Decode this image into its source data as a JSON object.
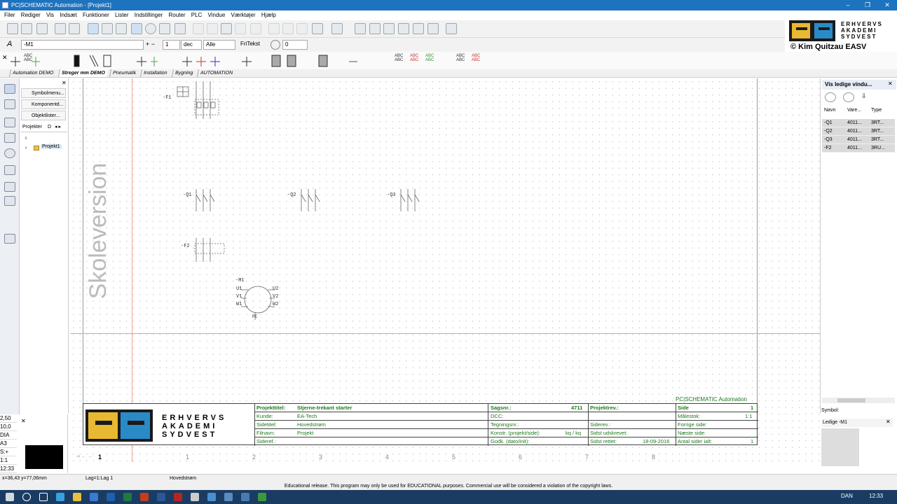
{
  "window": {
    "title": "PC|SCHEMATIC Automation - [Projekt1]"
  },
  "menu": [
    "Filer",
    "Rediger",
    "Vis",
    "Indsæt",
    "Funktioner",
    "Lister",
    "Indstillinger",
    "Router",
    "PLC",
    "Vindue",
    "Værktøjer",
    "Hjælp"
  ],
  "toolbar2": {
    "component_field": "-M1",
    "step": "1",
    "number_format": "dec",
    "filter": "Alle",
    "text_button": "FriTekst",
    "angle": "0"
  },
  "brand": {
    "line1": "ERHVERVS",
    "line2": "AKADEMI",
    "line3": "SYDVEST",
    "copyright": "© Kim Quitzau EASV"
  },
  "symbol_labels": [
    "ABC",
    "ABC",
    "ABC",
    "ABC",
    "ABC",
    "ABC",
    "ABC",
    "ABC",
    "ABC",
    "ABC",
    "ABC",
    "ABC"
  ],
  "tabs": [
    "Automation DEMO",
    "Streger mm DEMO",
    "Pneumatik",
    "Installation",
    "Bygning",
    "AUTOMATION"
  ],
  "active_tab": "Streger mm DEMO",
  "explorer": {
    "buttons": [
      "Symbolmenu...",
      "Komponentd...",
      "Objektlister..."
    ],
    "tab": "Projekter",
    "tab2": "D",
    "tree_item": "Projekt1"
  },
  "canvas": {
    "watermark": "Skoleversion",
    "page_number": "1",
    "ruler": [
      "1",
      "2",
      "3",
      "4",
      "5",
      "6",
      "7",
      "8"
    ]
  },
  "components": {
    "F1": "-F1",
    "Q1": "-Q1",
    "Q2": "-Q2",
    "Q3": "-Q3",
    "F2": "-F2",
    "M1": "-M1",
    "motor_left": [
      "U1",
      "V1",
      "W1"
    ],
    "motor_right": [
      "U2",
      "V2",
      "W2"
    ],
    "motor_bottom": "PE"
  },
  "title_block": {
    "product": "PC|SCHEMATIC Automation",
    "school": [
      "ERHVERVS",
      "AKADEMI",
      "SYDVEST"
    ],
    "projekttitel_label": "Projekttitel:",
    "projekttitel": "Stjerne-trekant starter",
    "kunde_label": "Kunde:",
    "kunde": "EA-Tech",
    "sidetitel_label": "Sidetitel:",
    "sidetitel": "Hovedstrøm",
    "filnavn_label": "Filnavn:",
    "filnavn": "Projekt",
    "sideref_label": "Sideref.:",
    "sagsnr_label": "Sagsnr.:",
    "sagsnr": "4711",
    "dcc_label": "DCC:",
    "tegningsnr_label": "Tegningsnr.:",
    "konstr_label": "Konstr. (projekt/side):",
    "konstr": "kq / kq",
    "godk_label": "Godk. (dato/init):",
    "projektrev_label": "Projektrev.:",
    "siderev_label": "Siderev.:",
    "sidst_udskrevet_label": "Sidst udskrevet:",
    "sidst_rettet_label": "Sidst rettet:",
    "sidst_rettet": "18-09-2016",
    "side_label": "Side",
    "side": "1",
    "malestok_label": "Målestok:",
    "malestok": "1:1",
    "forrige_label": "Forrige side:",
    "naeste_label": "Næste side:",
    "antal_label": "Antal sider ialt:",
    "antal": "1"
  },
  "right_panel": {
    "title": "Vis ledige vindu...",
    "columns": [
      "Navn",
      "Vare...",
      "Type"
    ],
    "rows": [
      [
        "-Q1",
        "4011...",
        "3RT..."
      ],
      [
        "-Q2",
        "4011...",
        "3RT..."
      ],
      [
        "-Q3",
        "4011...",
        "3RT..."
      ],
      [
        "-F2",
        "4011...",
        "3RU..."
      ]
    ],
    "symbol_label": "Symbol:",
    "symbol_value": "Ledige -M1"
  },
  "zoom": [
    "2,50",
    "10,0",
    "DIA",
    "A3",
    "S:+",
    "1:1",
    "12:33"
  ],
  "status": {
    "coords": "x=36,43 y=77,06mm",
    "layer": "Lag=1:Lag 1",
    "page": "Hovedstrøm"
  },
  "edu_notice": "Educational release. This program may only be used for EDUCATIONAL purposes. Commercial use will be considered a violation of the copyright laws.",
  "tray": {
    "lang": "DAN",
    "time": "12:33"
  }
}
